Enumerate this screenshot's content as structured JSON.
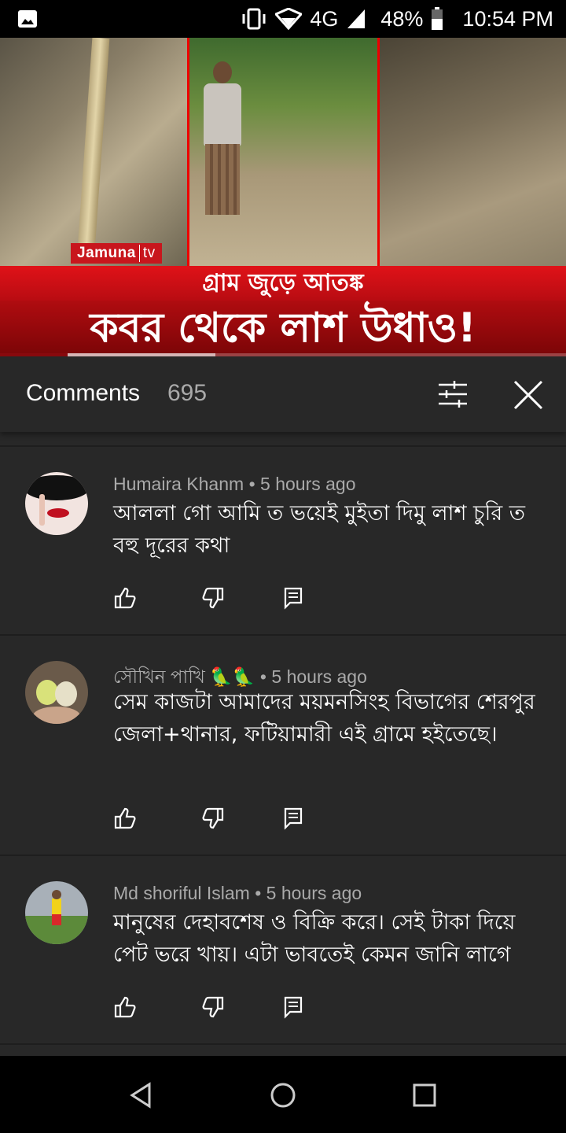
{
  "status_bar": {
    "network": "4G",
    "battery": "48%",
    "time": "10:54 PM",
    "icons": [
      "gallery-icon",
      "vibrate-icon",
      "wifi-icon",
      "signal-icon",
      "battery-icon"
    ]
  },
  "video": {
    "channel_logo": "Jamuna",
    "channel_logo_suffix": "tv",
    "banner_top": "গ্রাম জুড়ে আতঙ্ক",
    "banner_main": "কবর থেকে লাশ উধাও!",
    "progress_played": 0.12,
    "progress_buffered": 0.38
  },
  "comments_header": {
    "title": "Comments",
    "count": "695",
    "icons": [
      "sort-icon",
      "close-icon"
    ]
  },
  "comments": [
    {
      "author": "Humaira Khanm",
      "time": "5 hours ago",
      "text": "আললা গো আমি ত ভয়েই মুইতা দিমু লাশ চুরি ত বহু দূরের কথা",
      "avatar": "avatar-red-lips"
    },
    {
      "author": "সৌখিন পাখি 🦜🦜",
      "time": "5 hours ago",
      "text": "সেম কাজটা আমাদের ময়মনসিংহ বিভাগের শেরপুর জেলা+থানার, ফটিয়ামারী এই গ্রামে হইতেছে।",
      "avatar": "avatar-birds"
    },
    {
      "author": "Md shoriful Islam",
      "time": "5 hours ago",
      "text": "মানুষের দেহাবশেষ ও বিক্রি করে। সেই টাকা দিয়ে পেট ভরে খায়। এটা ভাবতেই কেমন জানি লাগে",
      "avatar": "avatar-football"
    }
  ],
  "comment_action_icons": [
    "like-icon",
    "dislike-icon",
    "reply-icon"
  ],
  "nav_bar": {
    "icons": [
      "back-icon",
      "home-icon",
      "recents-icon"
    ]
  }
}
